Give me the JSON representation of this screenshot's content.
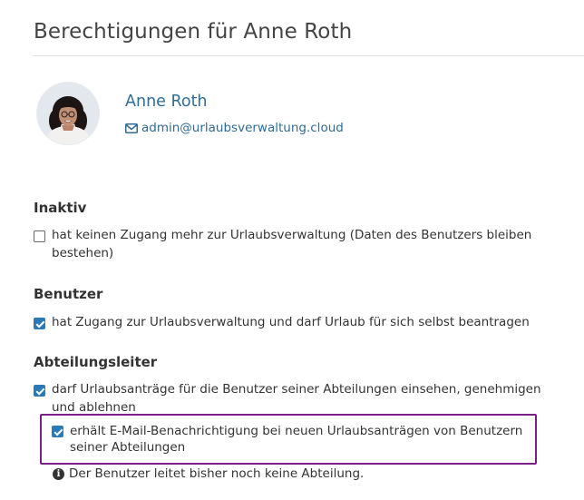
{
  "page": {
    "title": "Berechtigungen für Anne Roth"
  },
  "user": {
    "name": "Anne Roth",
    "email": "admin@urlaubsverwaltung.cloud",
    "email_icon": "envelope-icon"
  },
  "sections": {
    "inactive": {
      "title": "Inaktiv",
      "option": {
        "checked": false,
        "text": "hat keinen Zugang mehr zur Urlaubsverwaltung (Daten des Benutzers bleiben bestehen)"
      }
    },
    "user": {
      "title": "Benutzer",
      "option": {
        "checked": true,
        "text": "hat Zugang zur Urlaubsverwaltung und darf Urlaub für sich selbst beantragen"
      }
    },
    "department_head": {
      "title": "Abteilungsleiter",
      "option": {
        "checked": true,
        "text": "darf Urlaubsanträge für die Benutzer seiner Abteilungen einsehen, genehmigen und ablehnen"
      },
      "notification": {
        "checked": true,
        "text": "erhält E-Mail-Benachrichtigung bei neuen Urlaubsanträgen von Benutzern seiner Abteilungen"
      },
      "info": {
        "icon": "info-circle-icon",
        "text": "Der Benutzer leitet bisher noch keine Abteilung."
      }
    }
  },
  "colors": {
    "link": "#2f6c96",
    "checkbox_checked": "#2a7ab8",
    "highlight_border": "#7d1f8a"
  }
}
